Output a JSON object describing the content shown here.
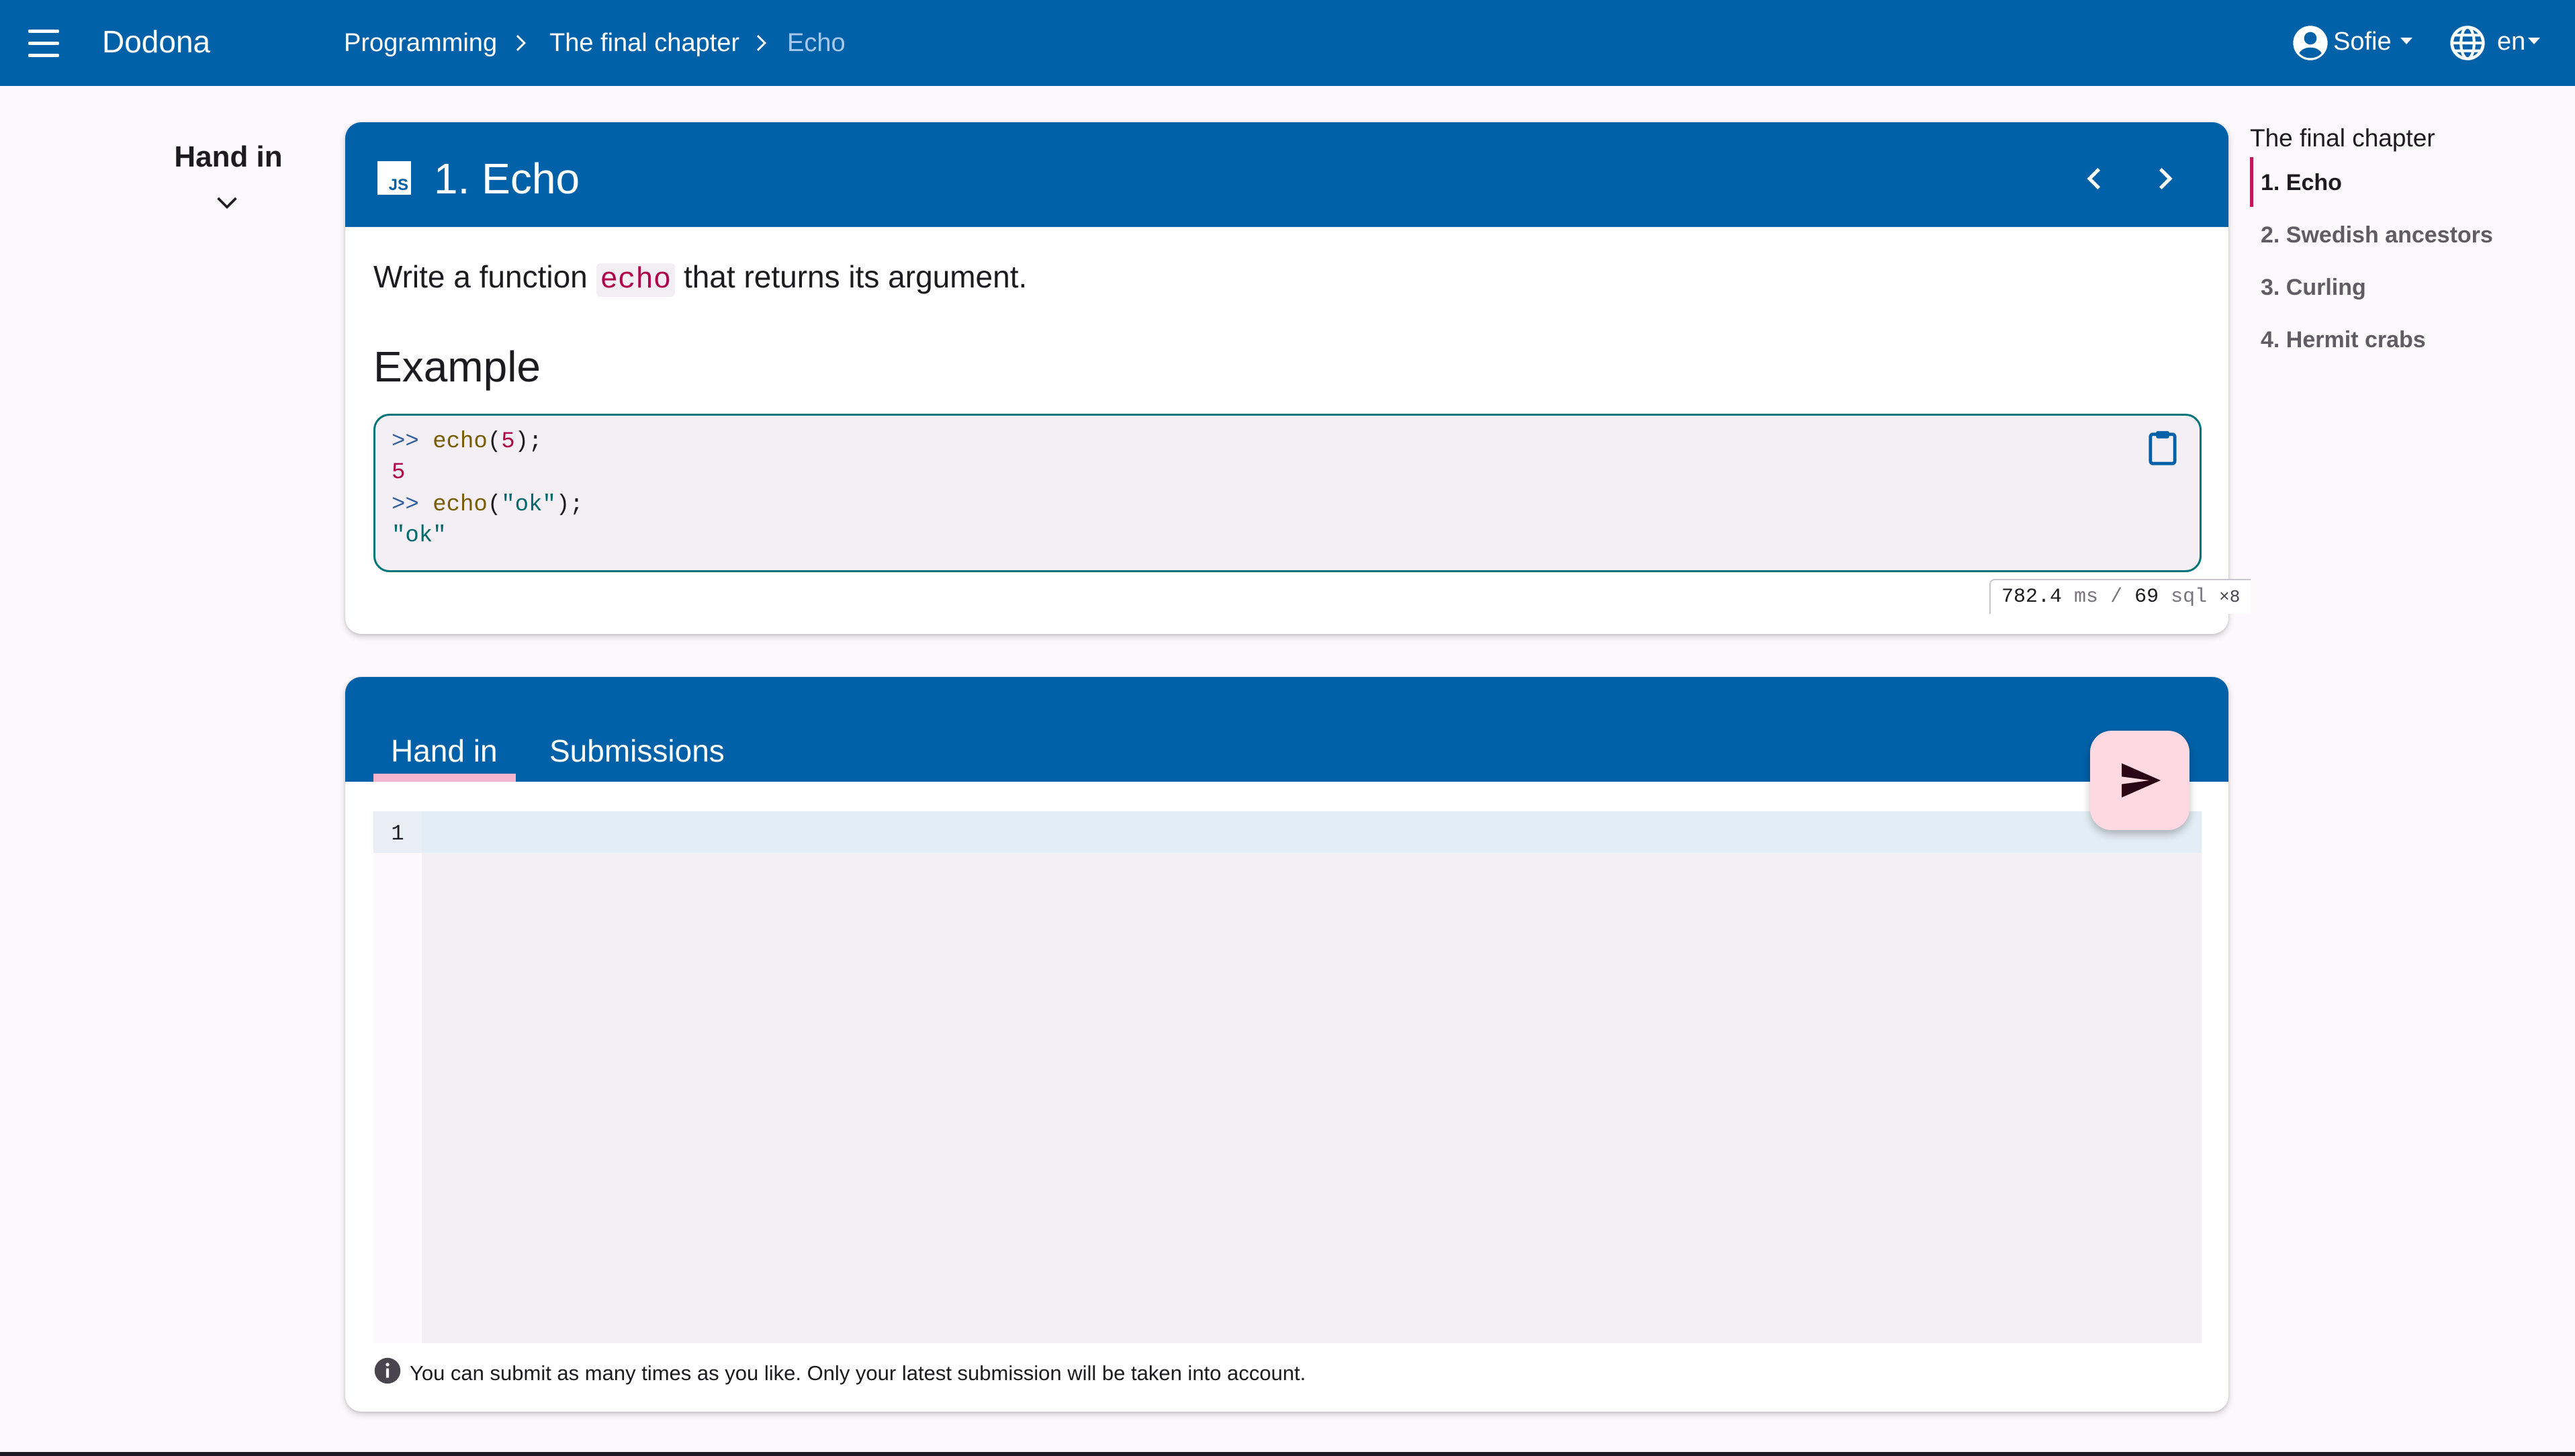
{
  "appbar": {
    "brand": "Dodona",
    "breadcrumbs": [
      "Programming",
      "The final chapter",
      "Echo"
    ],
    "user": "Sofie",
    "language": "en",
    "colors": {
      "primary": "#0061a8",
      "on_primary": "#ffffff"
    }
  },
  "sidebar": {
    "hand_in_label": "Hand in",
    "chevron_icon": "chevron-down-icon"
  },
  "exercise": {
    "title": "1. Echo",
    "language_badge": "JS",
    "description_prefix": "Write a function",
    "description_code": "echo",
    "description_suffix": "that returns its argument.",
    "example_heading": "Example",
    "code_lines": [
      {
        "prompt": ">> ",
        "fn": "echo",
        "open": "(",
        "arg": "5",
        "close": ");"
      },
      {
        "output": "5"
      },
      {
        "prompt": ">> ",
        "fn": "echo",
        "open": "(",
        "arg": "\"ok\"",
        "close": ");"
      },
      {
        "output": "\"ok\""
      }
    ],
    "perf": {
      "ms": "782.4",
      "ms_unit": "ms",
      "sep": "/",
      "sql": "69",
      "sql_unit": "sql",
      "mult": "×8"
    }
  },
  "submit": {
    "tabs": [
      {
        "label": "Hand in",
        "active": true
      },
      {
        "label": "Submissions",
        "active": false
      }
    ],
    "editor_line_number": "1",
    "info_text": "You can submit as many times as you like. Only your latest submission will be taken into account.",
    "fab_color": "#ffd9e2"
  },
  "toc": {
    "title": "The final chapter",
    "items": [
      {
        "label": "1. Echo",
        "active": true
      },
      {
        "label": "2. Swedish ancestors",
        "active": false
      },
      {
        "label": "3. Curling",
        "active": false
      },
      {
        "label": "4. Hermit crabs",
        "active": false
      }
    ],
    "accent": "#c2185b"
  }
}
